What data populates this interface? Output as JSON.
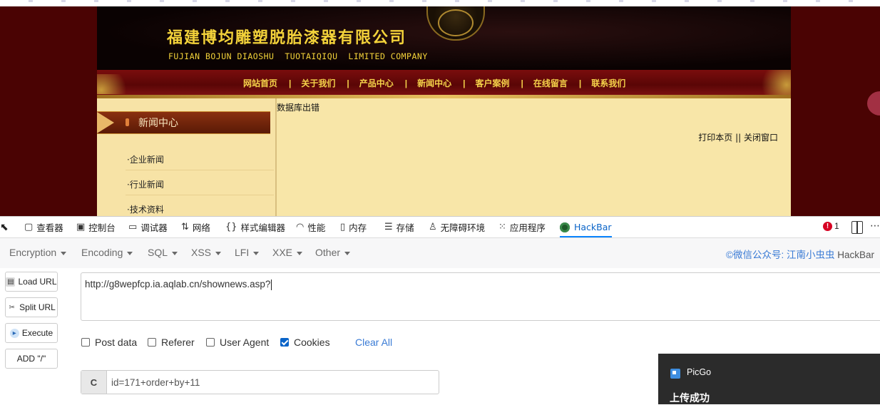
{
  "site": {
    "company_cn": "福建博均雕塑脱胎漆器有限公司",
    "company_en": "FUJIAN BOJUN DIAOSHU  TUOTAIQIQU  LIMITED COMPANY",
    "nav": [
      "网站首页",
      "关于我们",
      "产品中心",
      "新闻中心",
      "客户案例",
      "在线留言",
      "联系我们"
    ],
    "nav_separator": "|",
    "sidebar_title": "新闻中心",
    "sidebar_links": [
      "·企业新闻",
      "·行业新闻",
      "·技术资料"
    ],
    "db_error": "数据库出错",
    "print_page": "打印本页",
    "print_sep": " || ",
    "close_window": "关闭窗口"
  },
  "devtools": {
    "tabs": [
      {
        "label": "查看器",
        "icon": "inspector-icon"
      },
      {
        "label": "控制台",
        "icon": "console-icon"
      },
      {
        "label": "调试器",
        "icon": "debugger-icon"
      },
      {
        "label": "网络",
        "icon": "network-icon"
      },
      {
        "label": "样式编辑器",
        "icon": "style-editor-icon"
      },
      {
        "label": "性能",
        "icon": "performance-icon"
      },
      {
        "label": "内存",
        "icon": "memory-icon"
      },
      {
        "label": "存储",
        "icon": "storage-icon"
      },
      {
        "label": "无障碍环境",
        "icon": "accessibility-icon"
      },
      {
        "label": "应用程序",
        "icon": "application-icon"
      },
      {
        "label": "HackBar",
        "icon": "hackbar-icon"
      }
    ],
    "active_tab": "HackBar",
    "error_count": "1"
  },
  "hackbar": {
    "menus": [
      "Encryption",
      "Encoding",
      "SQL",
      "XSS",
      "LFI",
      "XXE",
      "Other"
    ],
    "credit": "©微信公众号: 江南小虫虫",
    "credit_suffix": " HackBar",
    "buttons": {
      "load_url": "Load URL",
      "split_url": "Split URL",
      "execute": "Execute",
      "add_slash": "ADD \"/\""
    },
    "url": "http://g8wepfcp.ia.aqlab.cn/shownews.asp?",
    "checks": [
      {
        "label": "Post data",
        "checked": false
      },
      {
        "label": "Referer",
        "checked": false
      },
      {
        "label": "User Agent",
        "checked": false
      },
      {
        "label": "Cookies",
        "checked": true
      }
    ],
    "clear_all": "Clear All",
    "cookie_label": "C",
    "cookie_value": "id=171+order+by+11"
  },
  "toast": {
    "app": "PicGo",
    "message": "上传成功"
  }
}
